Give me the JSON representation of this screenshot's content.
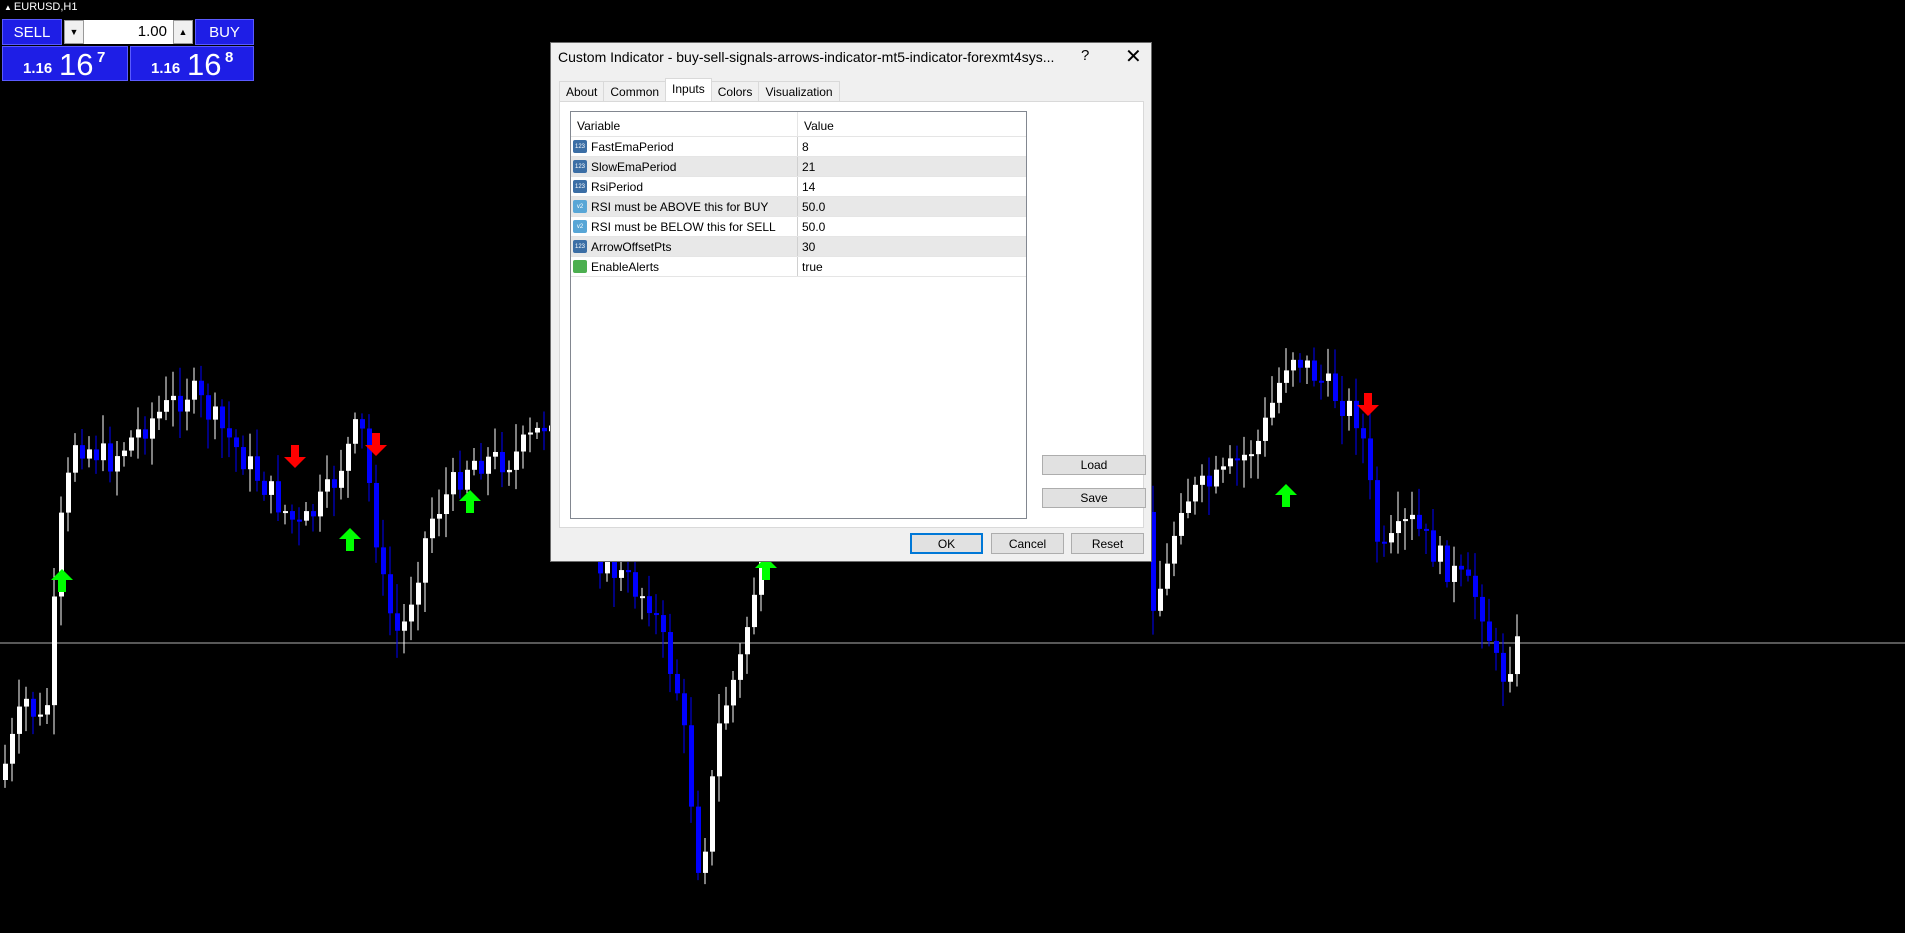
{
  "symbol": {
    "label": "EURUSD,H1"
  },
  "trade_panel": {
    "sell_label": "SELL",
    "buy_label": "BUY",
    "lot_value": "1.00",
    "sell_price_small": "1.16",
    "sell_price_big": "16",
    "sell_price_sup": "7",
    "buy_price_small": "1.16",
    "buy_price_big": "16",
    "buy_price_sup": "8"
  },
  "dialog": {
    "title": "Custom Indicator - buy-sell-signals-arrows-indicator-mt5-indicator-forexmt4sys...",
    "help": "?",
    "close": "✕",
    "tabs": [
      "About",
      "Common",
      "Inputs",
      "Colors",
      "Visualization"
    ],
    "active_tab": "Inputs",
    "columns": {
      "variable": "Variable",
      "value": "Value"
    },
    "rows": [
      {
        "variable": "FastEmaPeriod",
        "value": "8",
        "type": "int"
      },
      {
        "variable": "SlowEmaPeriod",
        "value": "21",
        "type": "int"
      },
      {
        "variable": "RsiPeriod",
        "value": "14",
        "type": "int"
      },
      {
        "variable": "RSI must be ABOVE this for BUY",
        "value": "50.0",
        "type": "dbl"
      },
      {
        "variable": "RSI must be BELOW this for SELL",
        "value": "50.0",
        "type": "dbl"
      },
      {
        "variable": "ArrowOffsetPts",
        "value": "30",
        "type": "int"
      },
      {
        "variable": "EnableAlerts",
        "value": "true",
        "type": "bool"
      }
    ],
    "load_label": "Load",
    "save_label": "Save",
    "ok_label": "OK",
    "cancel_label": "Cancel",
    "reset_label": "Reset"
  },
  "colors": {
    "bull_candle": "#ffffff",
    "bear_candle": "#0000ff",
    "buy_arrow": "#00ff00",
    "sell_arrow": "#ff0000",
    "background": "#000000"
  }
}
